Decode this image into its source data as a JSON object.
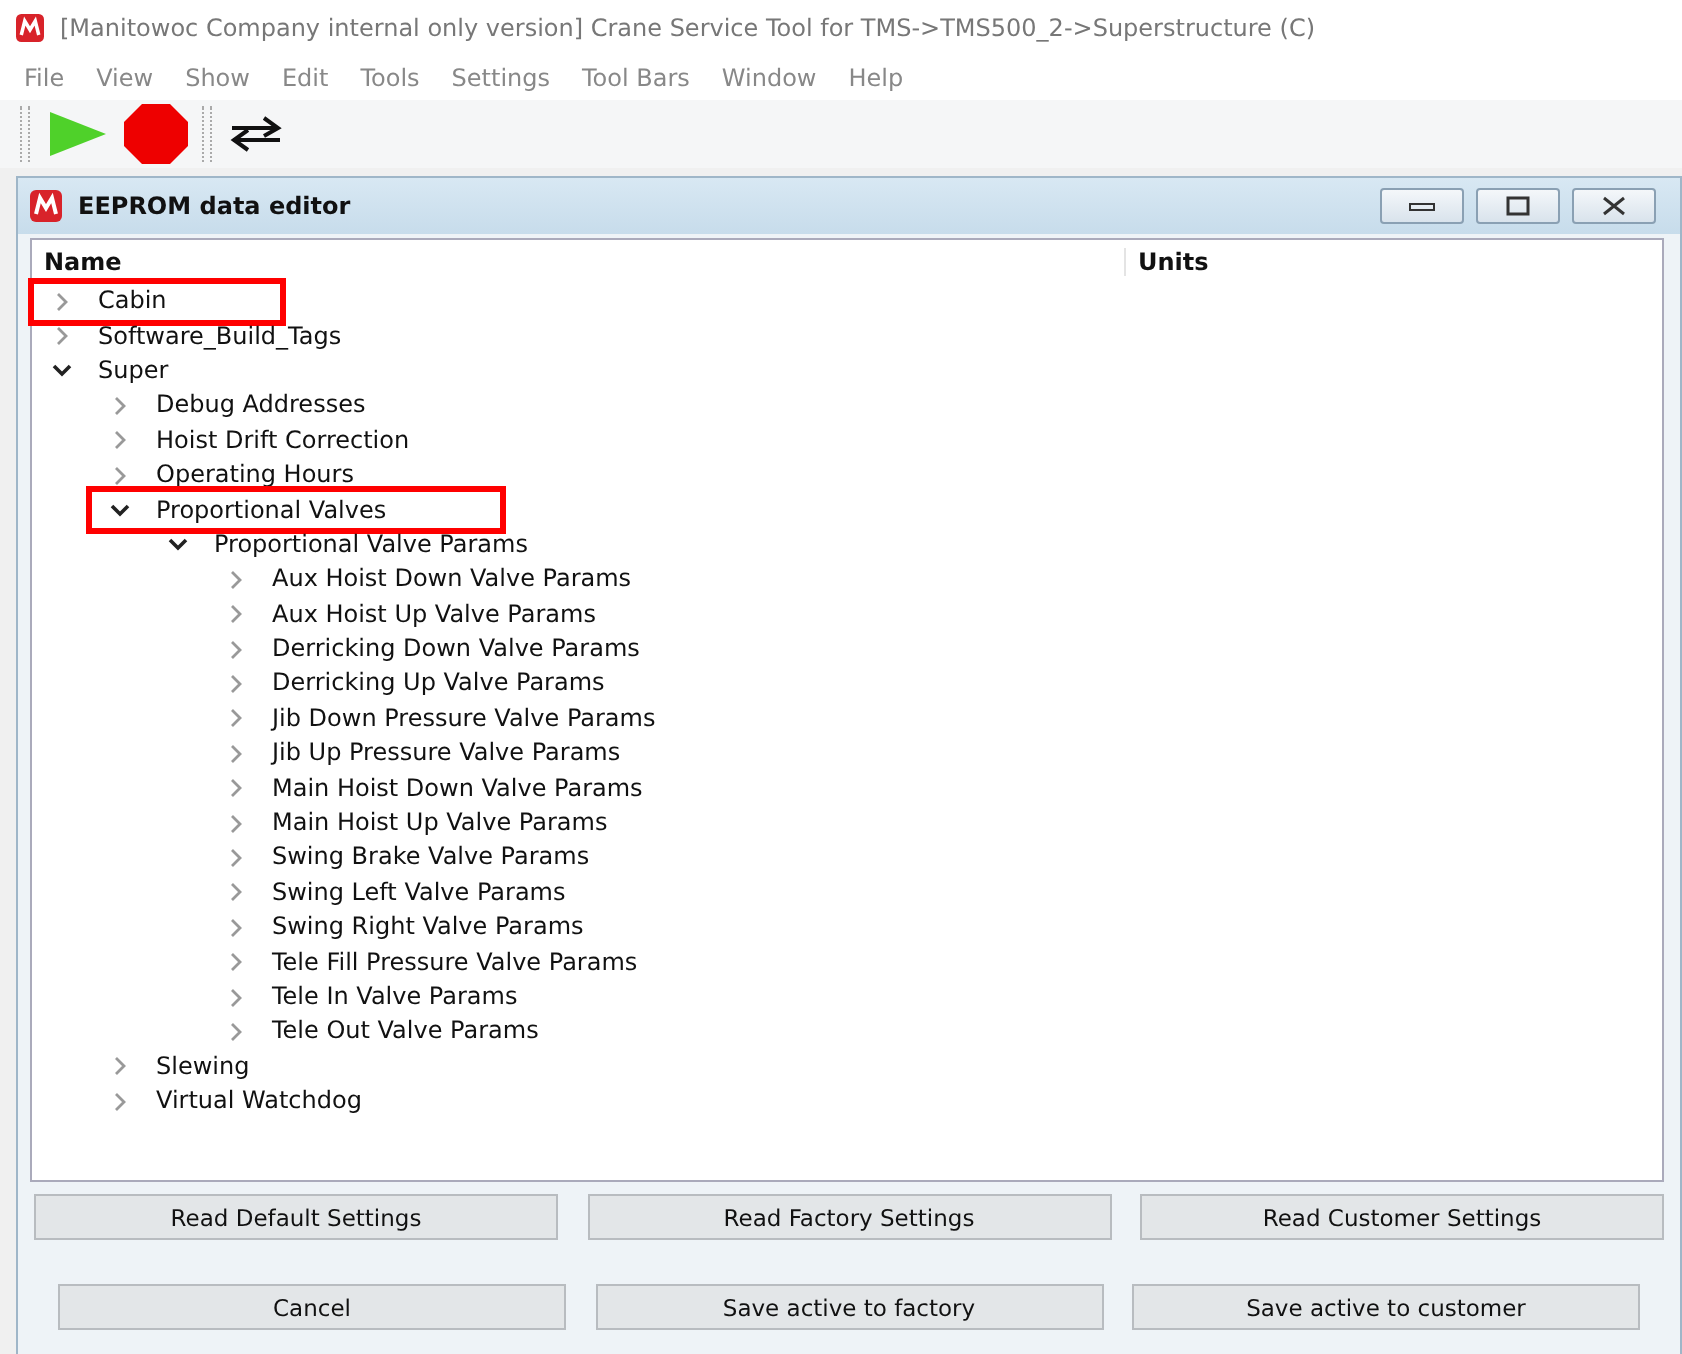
{
  "window": {
    "title": "[Manitowoc Company internal only  version] Crane Service Tool for TMS->TMS500_2->Superstructure (C)"
  },
  "menu": [
    "File",
    "View",
    "Show",
    "Edit",
    "Tools",
    "Settings",
    "Tool Bars",
    "Window",
    "Help"
  ],
  "editor": {
    "title": "EEPROM data editor",
    "columns": [
      "Name",
      "Units"
    ],
    "tree": [
      {
        "label": "Cabin",
        "expanded": false,
        "highlighted": true
      },
      {
        "label": "Software_Build_Tags",
        "expanded": false,
        "highlighted": false
      },
      {
        "label": "Super",
        "expanded": true,
        "highlighted": false,
        "children": [
          {
            "label": "Debug Addresses",
            "expanded": false,
            "highlighted": false
          },
          {
            "label": "Hoist Drift Correction",
            "expanded": false,
            "highlighted": false
          },
          {
            "label": "Operating Hours",
            "expanded": false,
            "highlighted": false
          },
          {
            "label": "Proportional Valves",
            "expanded": true,
            "highlighted": true,
            "children": [
              {
                "label": "Proportional Valve Params",
                "expanded": true,
                "highlighted": false,
                "children": [
                  {
                    "label": "Aux Hoist Down Valve Params",
                    "expanded": false,
                    "highlighted": false
                  },
                  {
                    "label": "Aux Hoist Up Valve Params",
                    "expanded": false,
                    "highlighted": false
                  },
                  {
                    "label": "Derricking Down Valve Params",
                    "expanded": false,
                    "highlighted": false
                  },
                  {
                    "label": "Derricking Up Valve Params",
                    "expanded": false,
                    "highlighted": false
                  },
                  {
                    "label": "Jib Down Pressure Valve Params",
                    "expanded": false,
                    "highlighted": false
                  },
                  {
                    "label": "Jib Up Pressure Valve Params",
                    "expanded": false,
                    "highlighted": false
                  },
                  {
                    "label": "Main Hoist Down Valve Params",
                    "expanded": false,
                    "highlighted": false
                  },
                  {
                    "label": "Main Hoist Up Valve Params",
                    "expanded": false,
                    "highlighted": false
                  },
                  {
                    "label": "Swing Brake Valve Params",
                    "expanded": false,
                    "highlighted": false
                  },
                  {
                    "label": "Swing Left Valve Params",
                    "expanded": false,
                    "highlighted": false
                  },
                  {
                    "label": "Swing Right Valve Params",
                    "expanded": false,
                    "highlighted": false
                  },
                  {
                    "label": "Tele Fill Pressure Valve Params",
                    "expanded": false,
                    "highlighted": false
                  },
                  {
                    "label": "Tele In Valve Params",
                    "expanded": false,
                    "highlighted": false
                  },
                  {
                    "label": "Tele Out Valve Params",
                    "expanded": false,
                    "highlighted": false
                  }
                ]
              }
            ]
          },
          {
            "label": "Slewing",
            "expanded": false,
            "highlighted": false
          },
          {
            "label": "Virtual Watchdog",
            "expanded": false,
            "highlighted": false
          }
        ]
      }
    ],
    "button_rows": [
      [
        "Read Default Settings",
        "Read Factory Settings",
        "Read Customer Settings"
      ],
      [
        "Cancel",
        "Save active to factory",
        "Save active to customer"
      ]
    ]
  }
}
